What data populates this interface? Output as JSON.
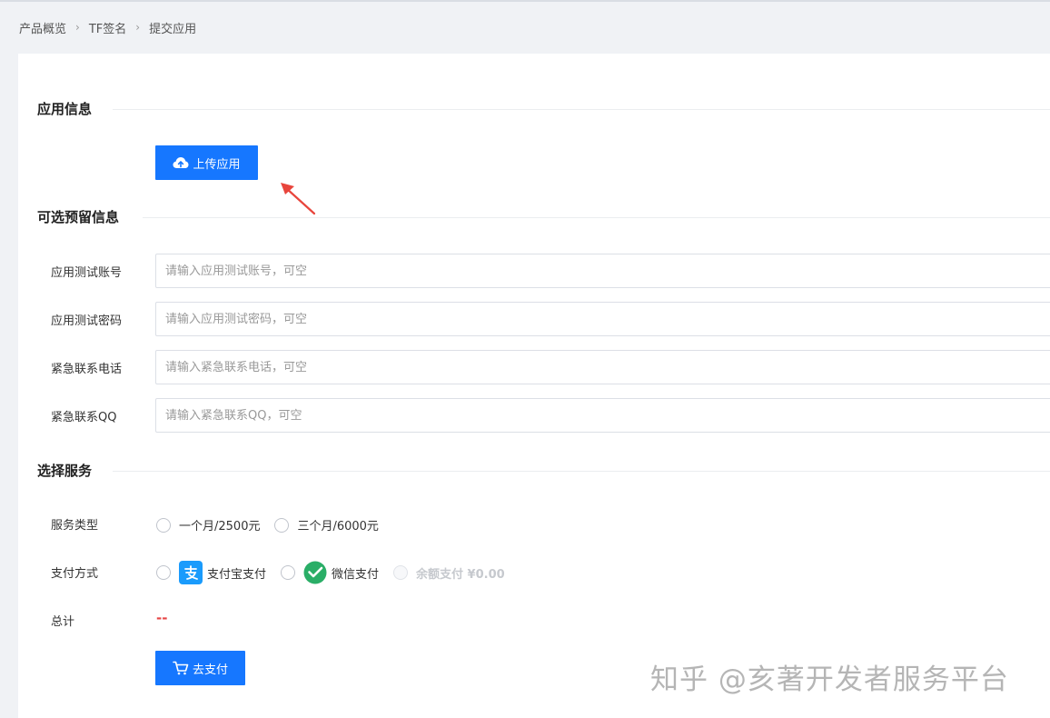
{
  "breadcrumb": {
    "items": [
      "产品概览",
      "TF签名",
      "提交应用"
    ],
    "separator": "›"
  },
  "app_info": {
    "title": "应用信息",
    "upload_button": "上传应用"
  },
  "optional_info": {
    "title": "可选预留信息",
    "fields": [
      {
        "label": "应用测试账号",
        "placeholder": "请输入应用测试账号，可空",
        "value": ""
      },
      {
        "label": "应用测试密码",
        "placeholder": "请输入应用测试密码，可空",
        "value": ""
      },
      {
        "label": "紧急联系电话",
        "placeholder": "请输入紧急联系电话，可空",
        "value": ""
      },
      {
        "label": "紧急联系QQ",
        "placeholder": "请输入紧急联系QQ，可空",
        "value": ""
      }
    ]
  },
  "service": {
    "title": "选择服务",
    "type_label": "服务类型",
    "type_options": [
      "一个月/2500元",
      "三个月/6000元"
    ],
    "payment_label": "支付方式",
    "payment_options": [
      "支付宝支付",
      "微信支付",
      "余额支付 ¥0.00"
    ],
    "total_label": "总计",
    "total_value": "--",
    "pay_button": "去支付"
  },
  "watermark": "知乎 @亥著开发者服务平台",
  "colors": {
    "primary": "#1677ff",
    "danger": "#e64545",
    "alipay": "#1a9bfc",
    "wechat": "#2aae67",
    "annotation_arrow": "#e8453c"
  },
  "icons": {
    "upload": "cloud-upload-icon",
    "cart": "shopping-cart-icon",
    "breadcrumb_sep": "chevron-right-icon"
  }
}
